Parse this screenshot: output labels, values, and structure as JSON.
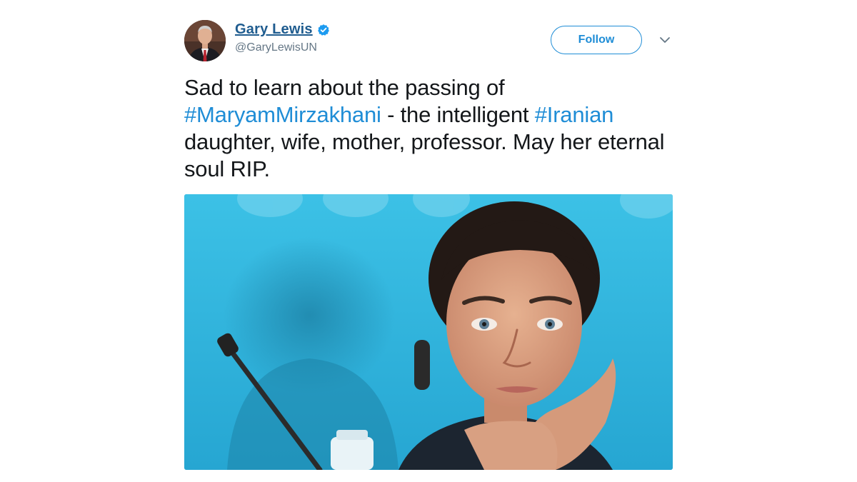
{
  "author": {
    "display_name": "Gary Lewis",
    "handle": "@GaryLewisUN",
    "verified_icon": "verified-badge-icon"
  },
  "actions": {
    "follow_label": "Follow",
    "menu_icon": "chevron-down-icon"
  },
  "tweet": {
    "text_1": "Sad to learn about the passing of ",
    "hashtag_1": "#MaryamMirzakhani",
    "text_2": " - the intelligent ",
    "hashtag_2": "#Iranian",
    "text_3": " daughter, wife, mother, professor. May her eternal soul RIP."
  },
  "colors": {
    "link": "#1f8dd6",
    "name": "#1f5c8f",
    "text": "#14171a",
    "muted": "#657786",
    "media_background": "#2eb4dd"
  }
}
